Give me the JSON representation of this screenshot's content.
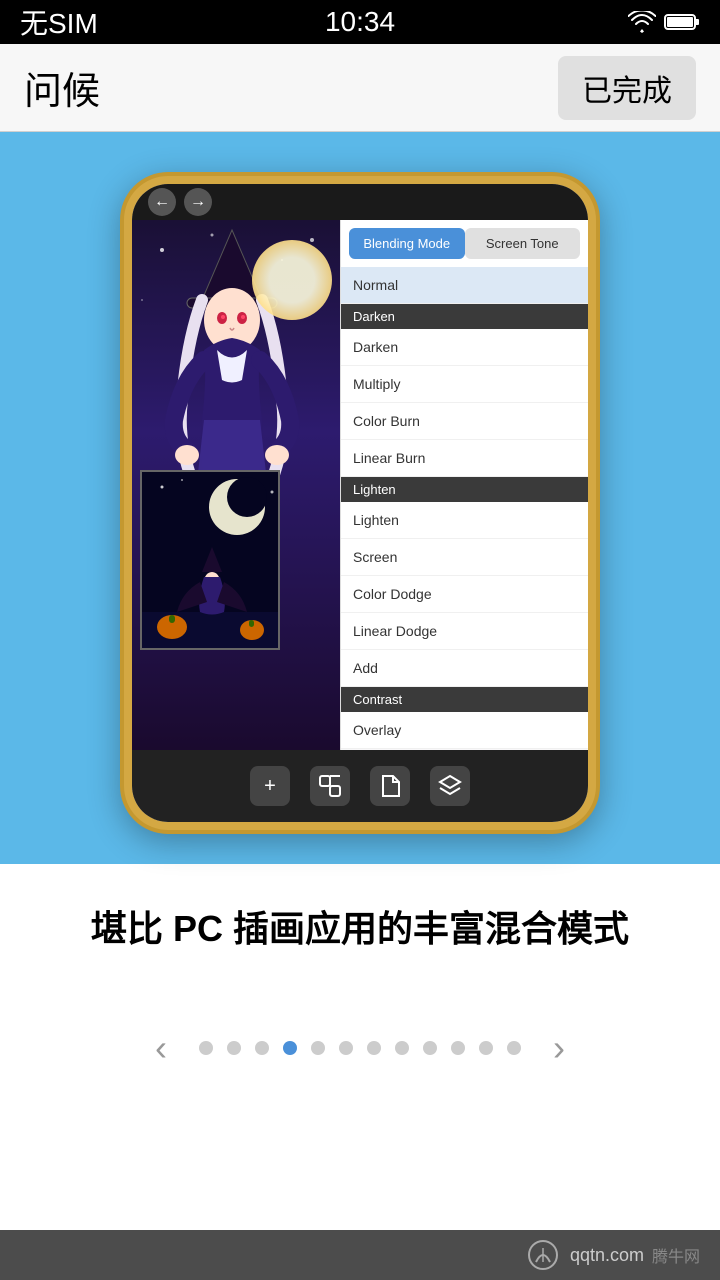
{
  "status_bar": {
    "carrier": "无SIM",
    "time": "10:34"
  },
  "nav": {
    "title": "问候",
    "done_btn": "已完成"
  },
  "blend_panel": {
    "tab_blend": "Blending Mode",
    "tab_tone": "Screen Tone",
    "categories": [
      {
        "name": "Normal",
        "items": [
          {
            "label": "Normal",
            "selected": true
          }
        ]
      },
      {
        "name": "Darken",
        "items": [
          {
            "label": "Darken",
            "selected": false
          },
          {
            "label": "Multiply",
            "selected": false
          },
          {
            "label": "Color Burn",
            "selected": false
          },
          {
            "label": "Linear Burn",
            "selected": false
          }
        ]
      },
      {
        "name": "Lighten",
        "items": [
          {
            "label": "Lighten",
            "selected": false
          },
          {
            "label": "Screen",
            "selected": false
          },
          {
            "label": "Color Dodge",
            "selected": false
          },
          {
            "label": "Linear Dodge",
            "selected": false
          },
          {
            "label": "Add",
            "selected": false
          }
        ]
      },
      {
        "name": "Contrast",
        "items": [
          {
            "label": "Overlay",
            "selected": false
          }
        ]
      }
    ]
  },
  "caption": "堪比 PC 插画应用的丰富混合模式",
  "pagination": {
    "total_dots": 12,
    "active_index": 3
  },
  "watermark": "qqtn.com",
  "toolbar_icons": [
    "+",
    "⊞",
    "⊟",
    "⊠"
  ]
}
